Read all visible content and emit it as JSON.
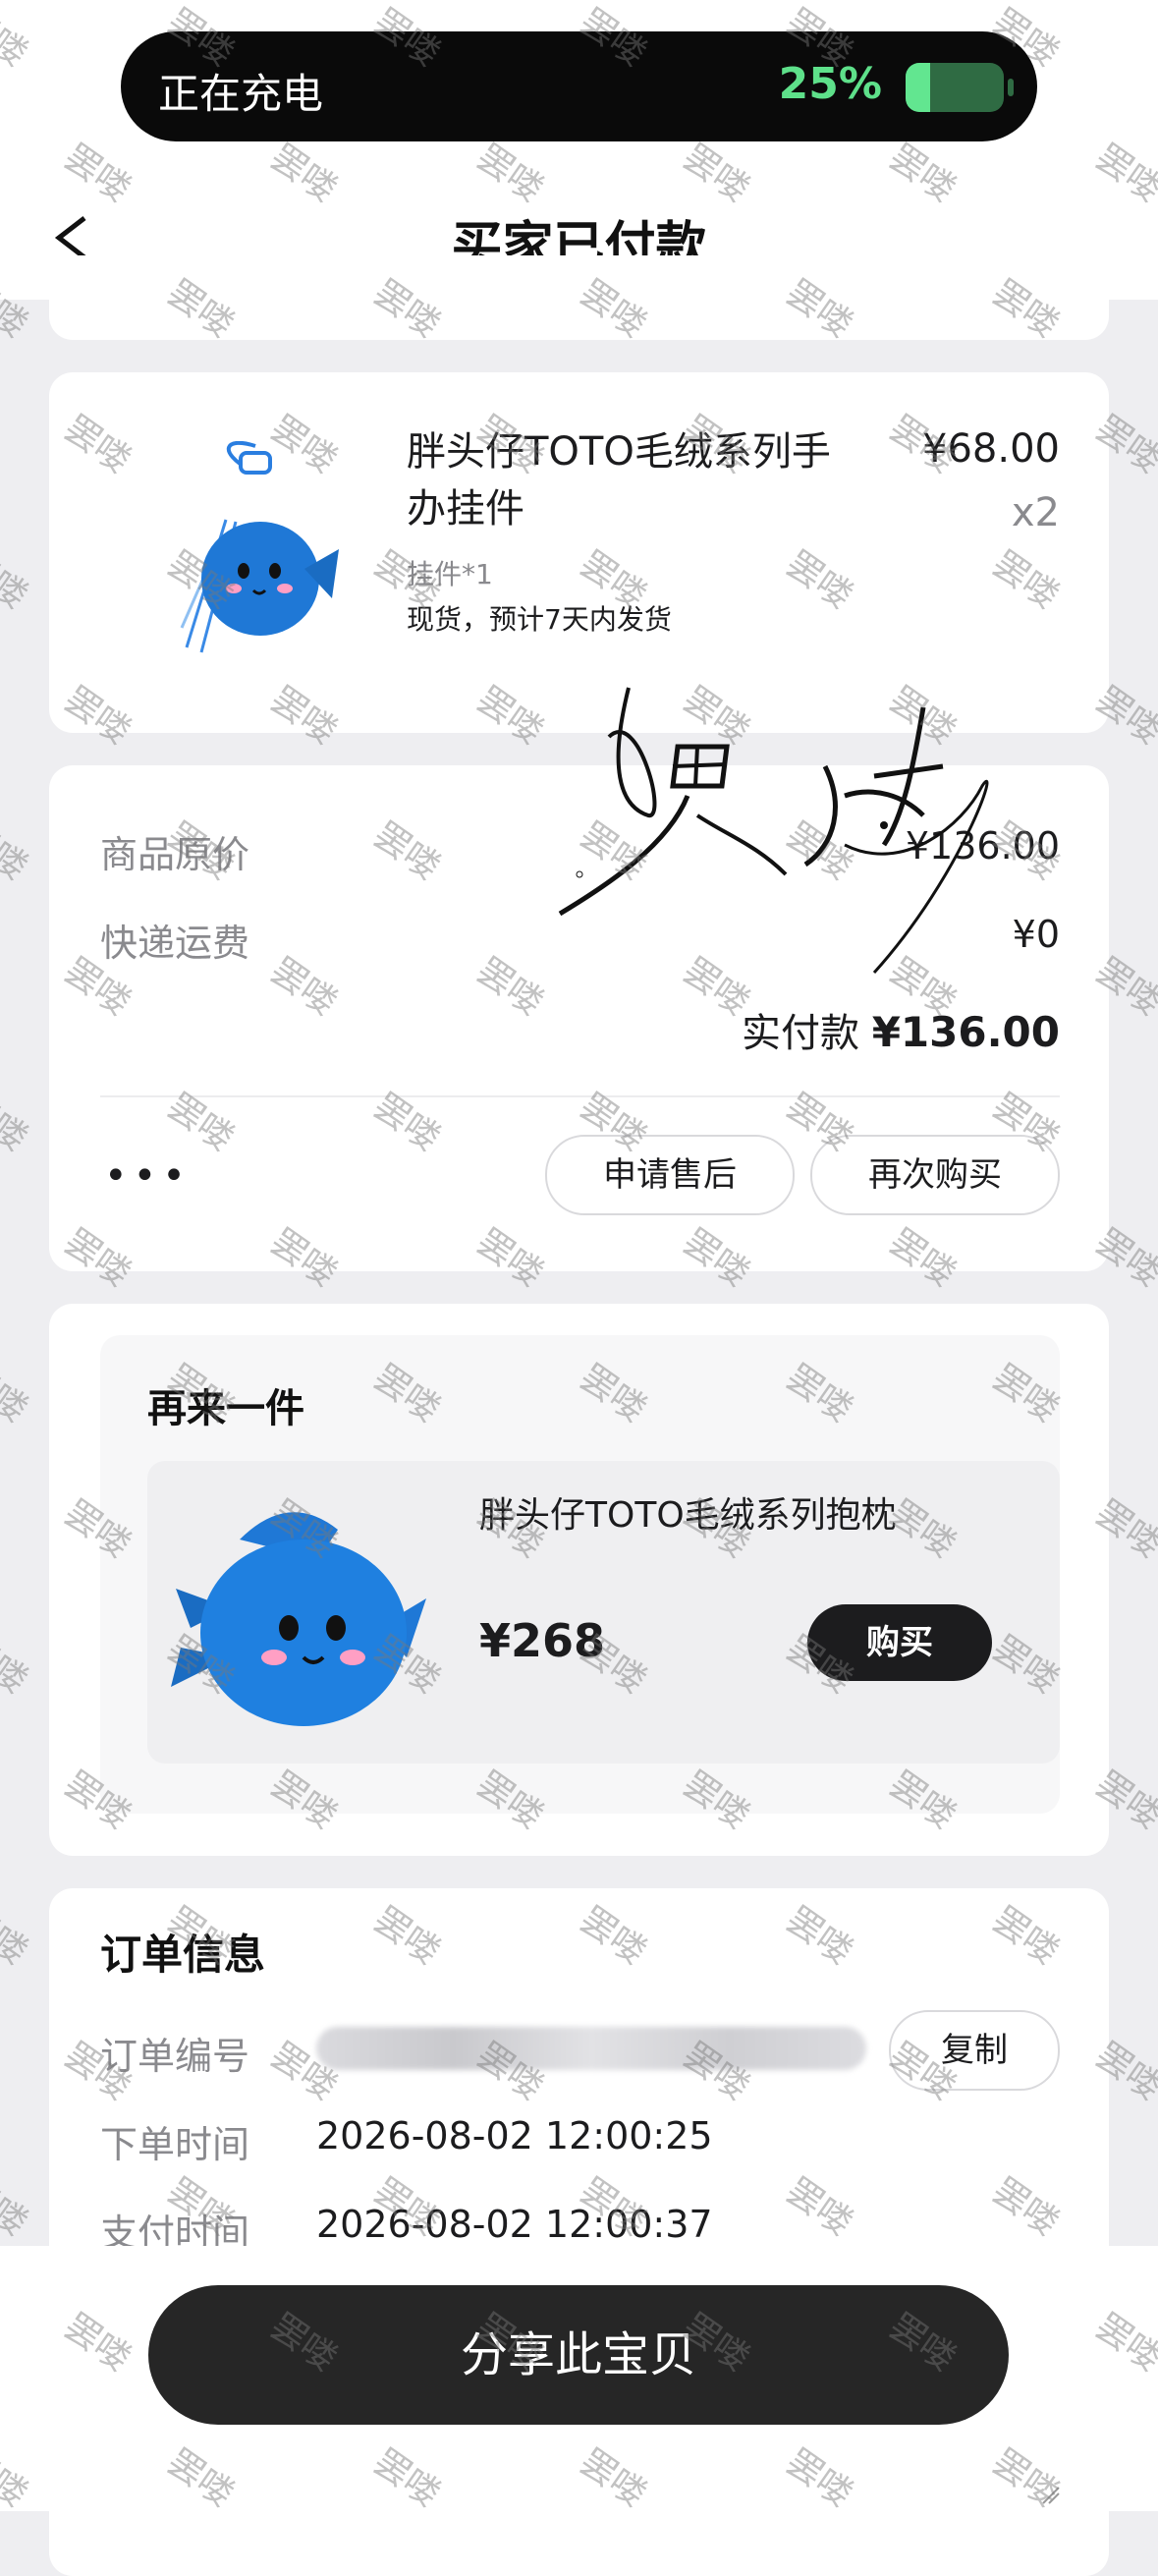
{
  "status": {
    "charging_label": "正在充电",
    "battery_percent": "25%",
    "battery_level": 0.25
  },
  "nav": {
    "title": "买家已付款"
  },
  "product": {
    "name": "胖头仔TOTO毛绒系列手办挂件",
    "price": "¥68.00",
    "quantity": "x2",
    "spec": "挂件*1",
    "shipping_note": "现货，预计7天内发货"
  },
  "pricing": {
    "original_label": "商品原价",
    "original_value": "¥136.00",
    "shipping_label": "快递运费",
    "shipping_value": "¥0",
    "paid_label": "实付款",
    "paid_value": "¥136.00",
    "more_label": "•••",
    "after_sale_label": "申请售后",
    "rebuy_label": "再次购买"
  },
  "again": {
    "title": "再来一件",
    "item_name": "胖头仔TOTO毛绒系列抱枕",
    "item_price": "¥268",
    "buy_label": "购买"
  },
  "order_info": {
    "title": "订单信息",
    "number_label": "订单编号",
    "copy_label": "复制",
    "order_time_label": "下单时间",
    "order_time_value": "2026-08-02 12:00:25",
    "pay_time_label": "支付时间",
    "pay_time_value": "2026-08-02 12:00:37"
  },
  "bottom": {
    "share_label": "分享此宝贝"
  },
  "watermark": {
    "text": "罢喽"
  },
  "colors": {
    "charge_green": "#5ee08a",
    "page_bg": "#eeeef1",
    "primary_dark": "#1c1c1e",
    "fish_blue": "#1f78d6"
  }
}
